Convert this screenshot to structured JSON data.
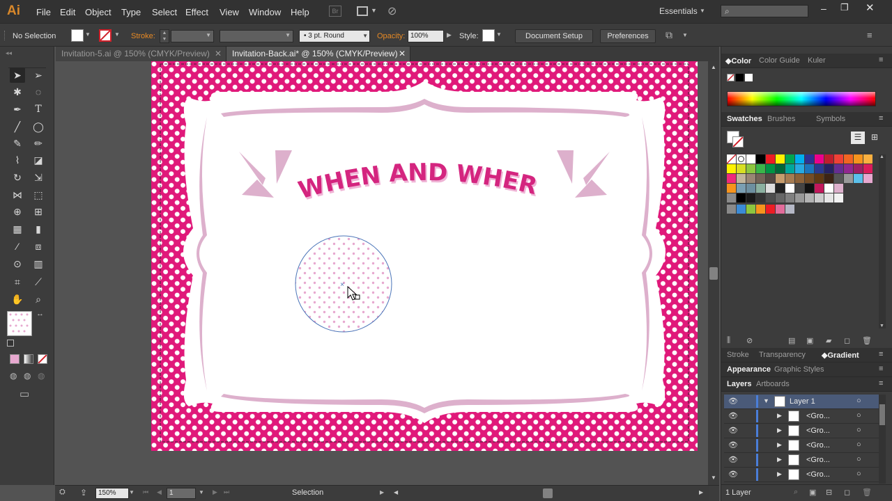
{
  "app": {
    "logo": "Ai"
  },
  "menu": [
    "File",
    "Edit",
    "Object",
    "Type",
    "Select",
    "Effect",
    "View",
    "Window",
    "Help"
  ],
  "workspace": "Essentials",
  "control_bar": {
    "selection": "No Selection",
    "stroke_label": "Stroke:",
    "stroke_style": "3 pt. Round",
    "opacity_label": "Opacity:",
    "opacity_value": "100%",
    "style_label": "Style:",
    "document_setup": "Document Setup",
    "preferences": "Preferences"
  },
  "tabs": [
    {
      "label": "Invitation-5.ai @ 150% (CMYK/Preview)",
      "active": false
    },
    {
      "label": "Invitation-Back.ai* @ 150% (CMYK/Preview)",
      "active": true
    }
  ],
  "artwork": {
    "heading": "WHEN AND WHERE",
    "bg_color": "#e0197a",
    "frame_color": "#ddb0cc"
  },
  "status": {
    "zoom": "150%",
    "artboard": "1",
    "tool": "Selection"
  },
  "panels": {
    "color_tabs": [
      "Color",
      "Color Guide",
      "Kuler"
    ],
    "swatch_tabs": [
      "Swatches",
      "Brushes",
      "Symbols"
    ],
    "stroke_tabs": [
      "Stroke",
      "Transparency",
      "Gradient"
    ],
    "appearance_tabs": [
      "Appearance",
      "Graphic Styles"
    ],
    "layers_tabs": [
      "Layers",
      "Artboards"
    ],
    "layers": [
      {
        "name": "Layer 1"
      },
      {
        "name": "<Gro..."
      },
      {
        "name": "<Gro..."
      },
      {
        "name": "<Gro..."
      },
      {
        "name": "<Gro..."
      },
      {
        "name": "<Gro..."
      }
    ],
    "layers_footer": "1 Layer"
  },
  "swatch_colors": [
    "#ffffff",
    "#000000",
    "#ed1c24",
    "#fff200",
    "#00a651",
    "#00aeef",
    "#2e3192",
    "#ec008c",
    "#f7941d",
    "#8dc63f",
    "#662d91",
    "#c69c6d",
    "#754c24",
    "#939598",
    "#d1d3d4"
  ]
}
